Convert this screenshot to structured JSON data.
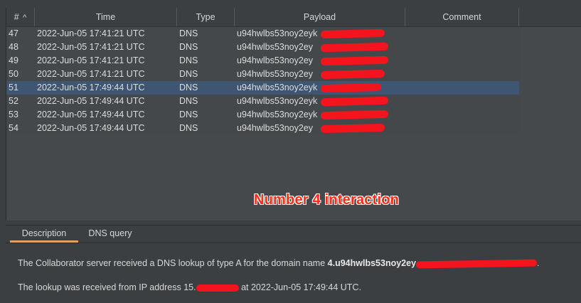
{
  "table": {
    "columns": [
      {
        "label": "#",
        "sort": "^"
      },
      {
        "label": "Time"
      },
      {
        "label": "Type"
      },
      {
        "label": "Payload"
      },
      {
        "label": "Comment"
      }
    ],
    "rows": [
      {
        "num": "47",
        "time": "2022-Jun-05 17:41:21 UTC",
        "type": "DNS",
        "payload": "u94hwlbs53noy2eyk",
        "selected": false
      },
      {
        "num": "48",
        "time": "2022-Jun-05 17:41:21 UTC",
        "type": "DNS",
        "payload": "u94hwlbs53noy2ey",
        "selected": false
      },
      {
        "num": "49",
        "time": "2022-Jun-05 17:41:21 UTC",
        "type": "DNS",
        "payload": "u94hwlbs53noy2ey",
        "selected": false
      },
      {
        "num": "50",
        "time": "2022-Jun-05 17:41:21 UTC",
        "type": "DNS",
        "payload": "u94hwlbs53noy2ey",
        "selected": false
      },
      {
        "num": "51",
        "time": "2022-Jun-05 17:49:44 UTC",
        "type": "DNS",
        "payload": "u94hwlbs53noy2eyk",
        "selected": true
      },
      {
        "num": "52",
        "time": "2022-Jun-05 17:49:44 UTC",
        "type": "DNS",
        "payload": "u94hwlbs53noy2eyk",
        "selected": false
      },
      {
        "num": "53",
        "time": "2022-Jun-05 17:49:44 UTC",
        "type": "DNS",
        "payload": "u94hwlbs53noy2eyk",
        "selected": false
      },
      {
        "num": "54",
        "time": "2022-Jun-05 17:49:44 UTC",
        "type": "DNS",
        "payload": "u94hwlbs53noy2ey",
        "selected": false
      }
    ]
  },
  "annotation": "Number 4 interaction",
  "tabs": [
    {
      "label": "Description",
      "active": true
    },
    {
      "label": "DNS query",
      "active": false
    }
  ],
  "description": {
    "line1_prefix": "The Collaborator server received a DNS lookup of type A for the domain name ",
    "line1_domain": "4.u94hwlbs53noy2ey",
    "line1_suffix": ".",
    "line2_prefix": "The lookup was received from IP address 15.",
    "line2_suffix": " at 2022-Jun-05 17:49:44 UTC."
  },
  "colors": {
    "redaction": "#f4141e",
    "annotation": "#ff2a12",
    "selected_row": "#3f5673",
    "active_tab_underline": "#e0a060"
  }
}
